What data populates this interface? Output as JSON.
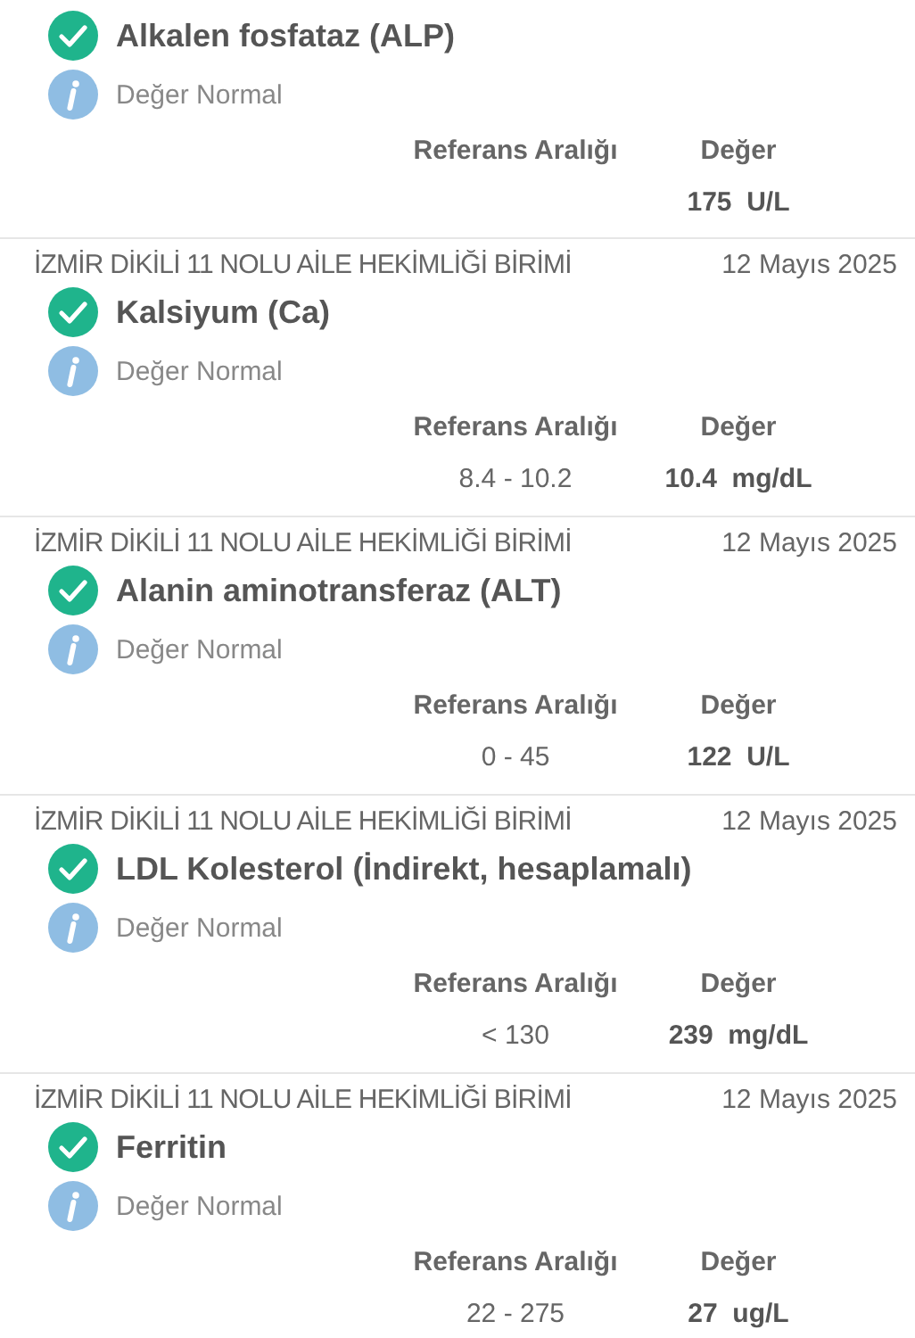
{
  "results": [
    {
      "test": "Alkalen fosfataz (ALP)",
      "kind": "normal",
      "note": "Değer Normal",
      "range_label": "Referans Aralığı",
      "value_label": "Değer",
      "value": "175  U/L"
    },
    {
      "institution": "İZMİR DİKİLİ 11 NOLU AİLE HEKİMLİĞİ BİRİMİ",
      "date": "12 Mayıs 2025",
      "test": "Kalsiyum (Ca)",
      "kind": "normal",
      "note": "Değer Normal",
      "range_label": "Referans Aralığı",
      "value_label": "Değer",
      "range": "8.4 - 10.2",
      "value": "10.4  mg/dL"
    },
    {
      "institution": "İZMİR DİKİLİ 11 NOLU AİLE HEKİMLİĞİ BİRİMİ",
      "date": "12 Mayıs 2025",
      "test": "Alanin aminotransferaz (ALT)",
      "kind": "normal",
      "note": "Değer Normal",
      "range_label": "Referans Aralığı",
      "value_label": "Değer",
      "range": "0 - 45",
      "value": "122  U/L"
    },
    {
      "institution": "İZMİR DİKİLİ 11 NOLU AİLE HEKİMLİĞİ BİRİMİ",
      "date": "12 Mayıs 2025",
      "test": "LDL Kolesterol (İndirekt, hesaplamalı)",
      "kind": "normal",
      "note": "Değer Normal",
      "range_label": "Referans Aralığı",
      "value_label": "Değer",
      "range": "< 130",
      "value": "239  mg/dL"
    },
    {
      "institution": "İZMİR DİKİLİ 11 NOLU AİLE HEKİMLİĞİ BİRİMİ",
      "date": "12 Mayıs 2025",
      "test": "Ferritin",
      "kind": "normal",
      "note": "Değer Normal",
      "range_label": "Referans Aralığı",
      "value_label": "Değer",
      "range": "22 - 275",
      "value": "27  ug/L"
    }
  ]
}
